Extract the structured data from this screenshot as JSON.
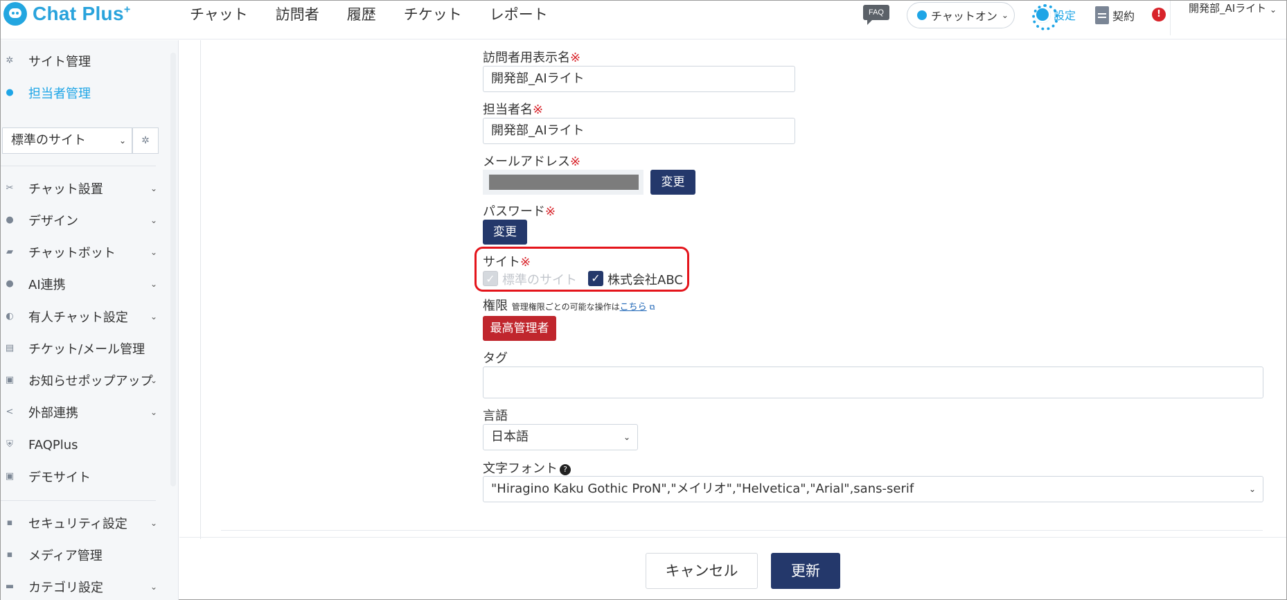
{
  "header": {
    "logo_text": "Chat Plus",
    "logo_plus": "+",
    "nav": [
      "チャット",
      "訪問者",
      "履歴",
      "チケット",
      "レポート"
    ],
    "faq_badge": "FAQ",
    "chat_status": "チャットオン",
    "settings_label": "設定",
    "contract_label": "契約",
    "alert_symbol": "!",
    "user_name": "開発部_AIライト"
  },
  "sidebar": {
    "top_items": [
      {
        "label": "サイト管理",
        "icon": "gear-icon"
      },
      {
        "label": "担当者管理",
        "icon": "user-gear-icon",
        "active": true
      }
    ],
    "site_select": "標準のサイト",
    "menu_items": [
      {
        "label": "チャット設置",
        "icon": "tools-icon",
        "expandable": true
      },
      {
        "label": "デザイン",
        "icon": "palette-icon",
        "expandable": true
      },
      {
        "label": "チャットボット",
        "icon": "chat-icon",
        "expandable": true
      },
      {
        "label": "AI連携",
        "icon": "ai-icon",
        "expandable": true
      },
      {
        "label": "有人チャット設定",
        "icon": "headset-icon",
        "expandable": true
      },
      {
        "label": "チケット/メール管理",
        "icon": "list-icon",
        "expandable": false
      },
      {
        "label": "お知らせポップアップ",
        "icon": "popup-icon",
        "expandable": true
      },
      {
        "label": "外部連携",
        "icon": "share-icon",
        "expandable": true
      },
      {
        "label": "FAQPlus",
        "icon": "shield-icon",
        "expandable": false
      },
      {
        "label": "デモサイト",
        "icon": "window-icon",
        "expandable": false
      }
    ],
    "bottom_items": [
      {
        "label": "セキュリティ設定",
        "icon": "lock-icon",
        "expandable": true
      },
      {
        "label": "メディア管理",
        "icon": "image-icon",
        "expandable": false
      },
      {
        "label": "カテゴリ設定",
        "icon": "folder-icon",
        "expandable": true
      }
    ]
  },
  "form": {
    "visitor_name_label": "訪問者用表示名",
    "visitor_name_value": "開発部_AIライト",
    "agent_name_label": "担当者名",
    "agent_name_value": "開発部_AIライト",
    "email_label": "メールアドレス",
    "change_label": "変更",
    "password_label": "パスワード",
    "required_mark": "※",
    "site_label": "サイト",
    "site_options": [
      {
        "label": "標準のサイト",
        "checked": true,
        "disabled": true
      },
      {
        "label": "株式会社ABC",
        "checked": true,
        "disabled": false
      }
    ],
    "permission_label": "権限",
    "permission_note": "管理権限ごとの可能な操作は",
    "permission_link": "こちら",
    "permission_value": "最高管理者",
    "tag_label": "タグ",
    "tag_value": "",
    "language_label": "言語",
    "language_value": "日本語",
    "font_label": "文字フォント",
    "font_value": "\"Hiragino Kaku Gothic ProN\",\"メイリオ\",\"Helvetica\",\"Arial\",sans-serif"
  },
  "actions": {
    "cancel_label": "キャンセル",
    "update_label": "更新"
  },
  "colors": {
    "brand": "#29a3dc",
    "navy_button": "#24386b",
    "admin_badge": "#c0262d",
    "highlight": "#e4141b",
    "required": "#d8232a"
  }
}
